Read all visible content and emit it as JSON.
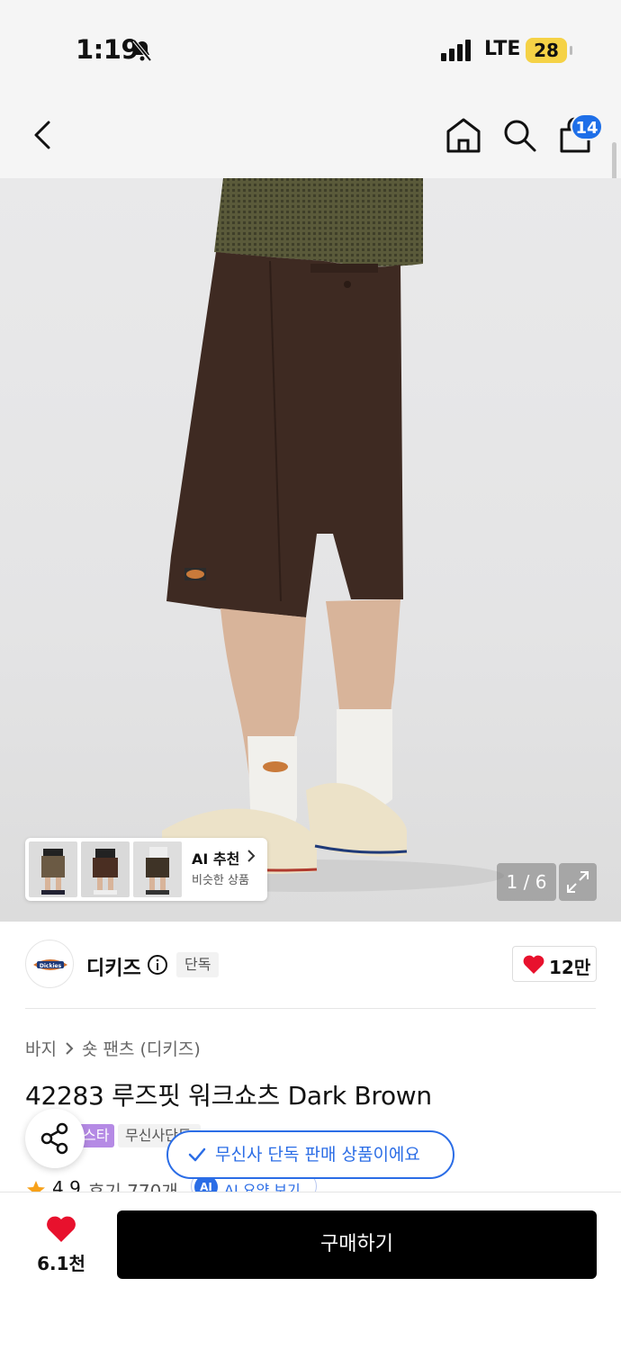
{
  "status": {
    "time": "1:19",
    "network": "LTE",
    "battery": "28"
  },
  "nav": {
    "cart_count": "14"
  },
  "gallery": {
    "counter": "1 / 6"
  },
  "ai_recommend": {
    "title": "AI 추천",
    "subtitle": "비슷한 상품"
  },
  "brand": {
    "name": "디키즈",
    "exclusive_tag": "단독",
    "likes": "12만"
  },
  "breadcrumb": {
    "category": "바지",
    "subcategory": "숏 팬츠 (디키즈)"
  },
  "product": {
    "title": "42283 루즈핏 워크쇼츠 Dark Brown",
    "tag_star": "스타",
    "tag_exclusive_sale": "무신사단독",
    "rating": "4.9",
    "reviews": "후기 770개",
    "ai_summary_label": "AI 요약 보기",
    "ai_badge": "AI"
  },
  "toast": {
    "message": "무신사 단독 판매 상품이에요"
  },
  "bottom_bar": {
    "wish_count": "6.1천",
    "buy_label": "구매하기"
  },
  "colors": {
    "accent_blue": "#2b6de6",
    "heart_red": "#e8112d",
    "star_orange": "#f7a11a",
    "tag_purple": "#b58ae5"
  }
}
